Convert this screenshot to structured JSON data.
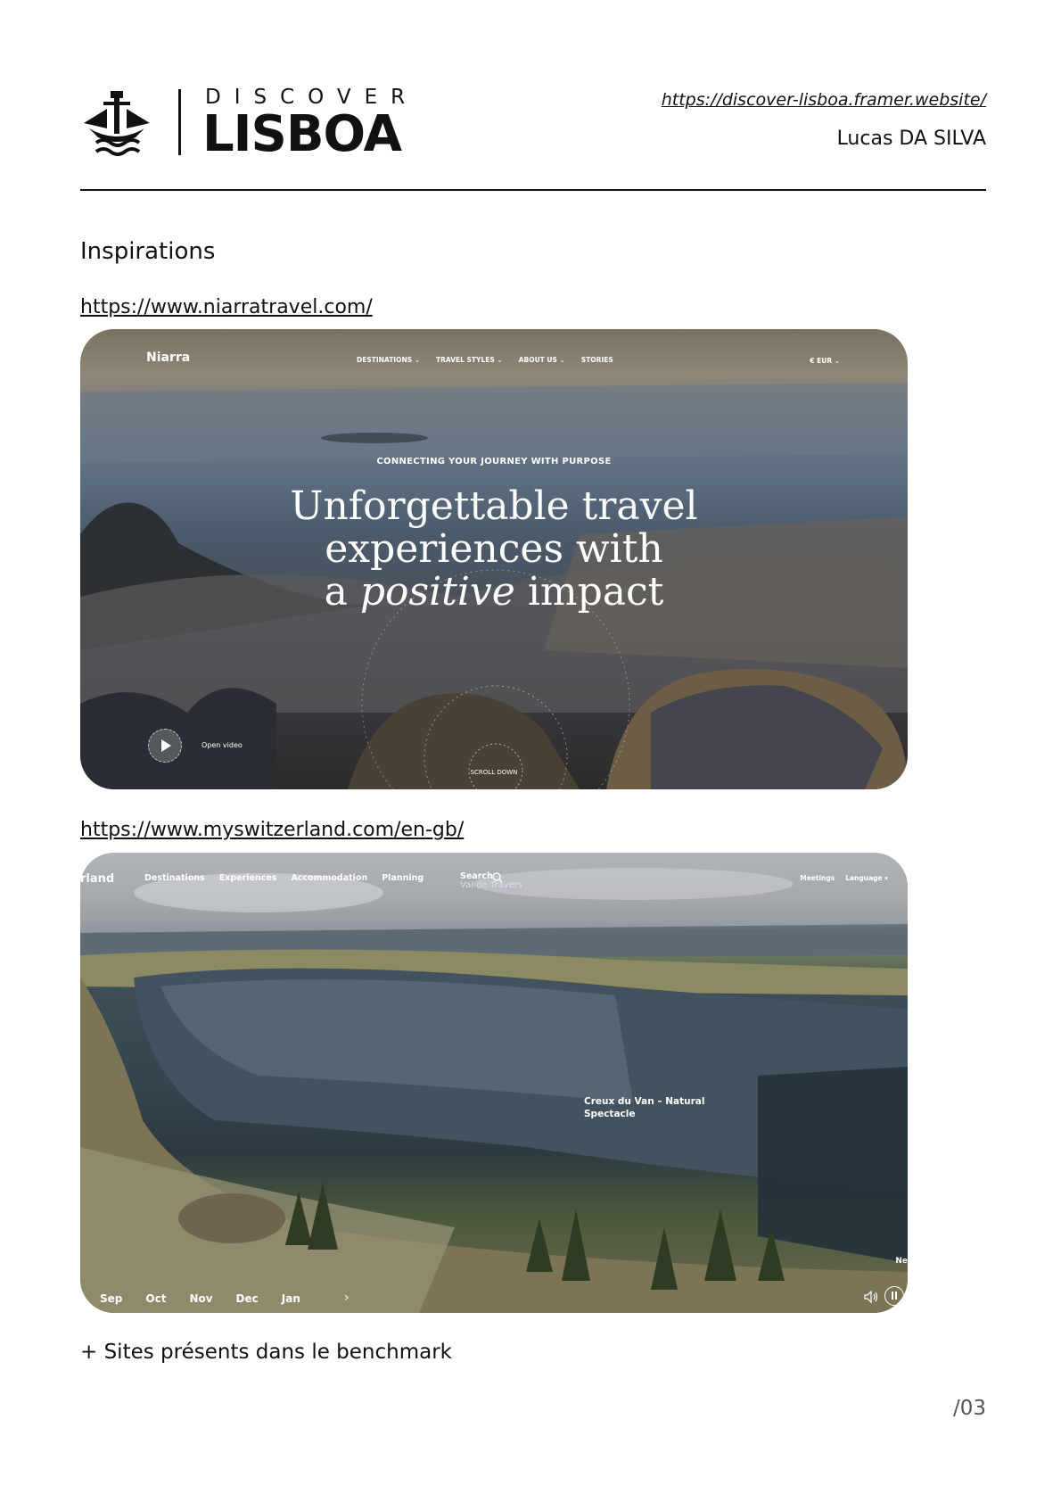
{
  "header": {
    "logo_top": "DISCOVER",
    "logo_main": "LISBOA",
    "site_url": "https://discover-lisboa.framer.website/",
    "author": "Lucas DA SILVA"
  },
  "section_title": "Inspirations",
  "inspirations": [
    {
      "url": "https://www.niarratravel.com/",
      "brand": "Niarra",
      "nav": [
        "DESTINATIONS ⌄",
        "TRAVEL STYLES ⌄",
        "ABOUT US ⌄",
        "STORIES"
      ],
      "currency": "€ EUR ⌄",
      "tagline": "CONNECTING YOUR JOURNEY WITH PURPOSE",
      "headline_1": "Unforgettable travel",
      "headline_2": "experiences with",
      "headline_3a": "a ",
      "headline_3b": "positive",
      "headline_3c": " impact",
      "open_video": "Open video",
      "scroll": "SCROLL DOWN"
    },
    {
      "url": "https://www.myswitzerland.com/en-gb/",
      "brand": "rland",
      "nav": [
        "Destinations",
        "Experiences",
        "Accommodation",
        "Planning"
      ],
      "search": "Search",
      "search_sub": "Val de Travers",
      "right_nav": [
        "Meetings",
        "Language ▾"
      ],
      "caption": "Creux du Van – Natural Spectacle",
      "months": [
        "Sep",
        "Oct",
        "Nov",
        "Dec",
        "Jan"
      ],
      "side": "Ne"
    }
  ],
  "footnote": "+ Sites présents dans le benchmark",
  "page_number": "/03"
}
